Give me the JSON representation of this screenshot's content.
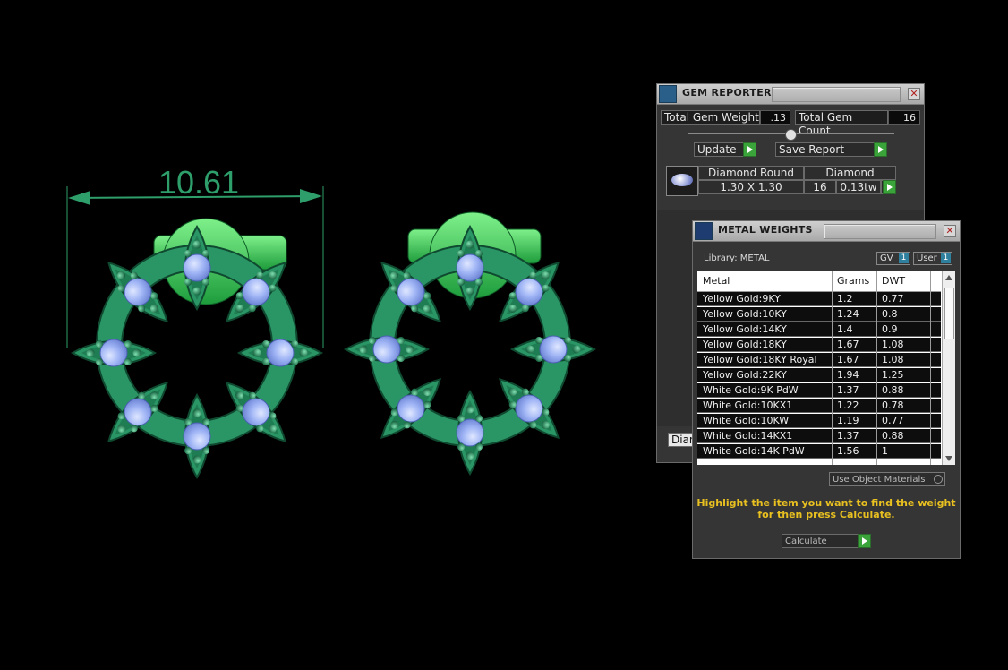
{
  "dimension": {
    "value": "10.61"
  },
  "gem_reporter": {
    "title": "GEM REPORTER",
    "total_gem_weight_label": "Total Gem Weight",
    "total_gem_weight_value": ".13",
    "total_gem_count_label": "Total Gem Count",
    "total_gem_count_value": "16",
    "update_label": "Update",
    "save_report_label": "Save Report",
    "gem_row": {
      "shape": "Diamond Round",
      "material": "Diamond",
      "size": "1.30 X 1.30",
      "count": "16",
      "weight": "0.13tw"
    },
    "bottom_tab_label": "Diam"
  },
  "metal_weights": {
    "title": "METAL WEIGHTS",
    "library_label": "Library: METAL",
    "gv_label": "GV",
    "gv_value": "1",
    "user_label": "User",
    "user_value": "1",
    "columns": [
      "Metal",
      "Grams",
      "DWT"
    ],
    "rows": [
      [
        "Yellow Gold:9KY",
        "1.2",
        "0.77"
      ],
      [
        "Yellow Gold:10KY",
        "1.24",
        "0.8"
      ],
      [
        "Yellow Gold:14KY",
        "1.4",
        "0.9"
      ],
      [
        "Yellow Gold:18KY",
        "1.67",
        "1.08"
      ],
      [
        "Yellow Gold:18KY Royal",
        "1.67",
        "1.08"
      ],
      [
        "Yellow Gold:22KY",
        "1.94",
        "1.25"
      ],
      [
        "White Gold:9K PdW",
        "1.37",
        "0.88"
      ],
      [
        "White Gold:10KX1",
        "1.22",
        "0.78"
      ],
      [
        "White Gold:10KW",
        "1.19",
        "0.77"
      ],
      [
        "White Gold:14KX1",
        "1.37",
        "0.88"
      ],
      [
        "White Gold:14K PdW",
        "1.56",
        "1"
      ]
    ],
    "use_object_materials_label": "Use Object Materials",
    "hint_line1": "Highlight the item you want to find the weight",
    "hint_line2": "for then press Calculate.",
    "calculate_label": "Calculate"
  },
  "colors": {
    "metal": "#2e9e6a",
    "gem": "#9fb4f5",
    "accent_green": "#3aa33a",
    "hint_yellow": "#e8c020"
  }
}
